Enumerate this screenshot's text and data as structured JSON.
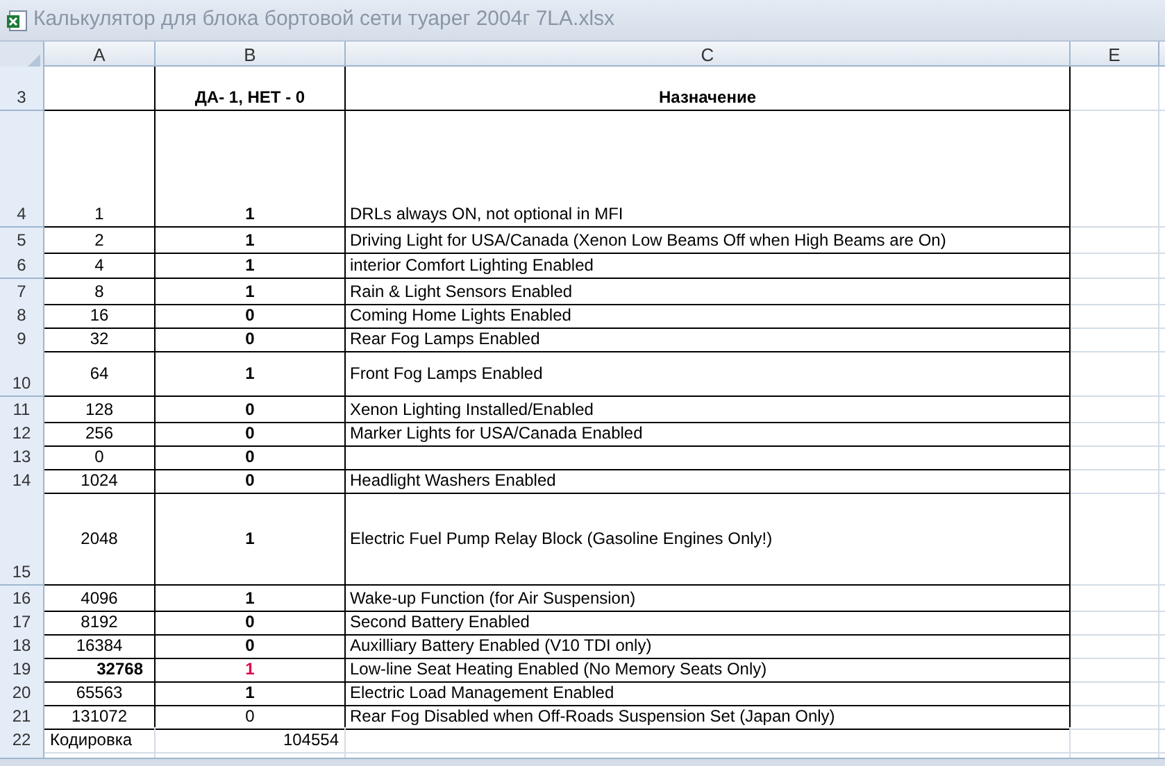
{
  "window": {
    "title": "Калькулятор для блока бортовой сети туарег  2004г 7LA.xlsx"
  },
  "columns": [
    "A",
    "B",
    "C",
    "E"
  ],
  "rows": [
    {
      "row": "3",
      "kind": "header",
      "a": "",
      "b": "ДА- 1, НЕТ - 0",
      "c": "Назначение"
    },
    {
      "row": "4",
      "kind": "normal",
      "a": "1",
      "b": "1",
      "c": "DRLs always ON, not optional in MFI"
    },
    {
      "row": "5",
      "kind": "normal",
      "a": "2",
      "b": "1",
      "c": "Driving Light for USA/Canada (Xenon Low Beams Off when High Beams are On)"
    },
    {
      "row": "6",
      "kind": "normal",
      "a": "4",
      "b": "1",
      "c": "interior Comfort Lighting Enabled"
    },
    {
      "row": "7",
      "kind": "normal",
      "a": "8",
      "b": "1",
      "c": "Rain & Light Sensors Enabled"
    },
    {
      "row": "8",
      "kind": "normal",
      "a": "16",
      "b": "0",
      "c": "Coming Home Lights Enabled"
    },
    {
      "row": "9",
      "kind": "normal",
      "a": "32",
      "b": "0",
      "c": "Rear Fog Lamps Enabled"
    },
    {
      "row": "10",
      "kind": "normal",
      "a": "64",
      "b": "1",
      "c": "Front Fog Lamps Enabled"
    },
    {
      "row": "11",
      "kind": "normal",
      "a": "128",
      "b": "0",
      "c": "Xenon Lighting Installed/Enabled"
    },
    {
      "row": "12",
      "kind": "normal",
      "a": "256",
      "b": "0",
      "c": "Marker Lights for USA/Canada Enabled"
    },
    {
      "row": "13",
      "kind": "normal",
      "a": "0",
      "b": "0",
      "c": ""
    },
    {
      "row": "14",
      "kind": "normal",
      "a": "1024",
      "b": "0",
      "c": "Headlight Washers Enabled"
    },
    {
      "row": "15",
      "kind": "normal",
      "a": "2048",
      "b": "1",
      "c": "Electric Fuel Pump Relay Block (Gasoline Engines Only!)"
    },
    {
      "row": "16",
      "kind": "normal",
      "a": "4096",
      "b": "1",
      "c": "Wake-up Function (for Air Suspension)"
    },
    {
      "row": "17",
      "kind": "normal",
      "a": "8192",
      "b": "0",
      "c": "Second Battery Enabled"
    },
    {
      "row": "18",
      "kind": "normal",
      "a": "16384",
      "b": "0",
      "c": "Auxilliary Battery Enabled (V10 TDI only)"
    },
    {
      "row": "19",
      "kind": "highlight",
      "a": "32768",
      "b": "1",
      "c": "Low-line Seat Heating Enabled (No Memory Seats Only)"
    },
    {
      "row": "20",
      "kind": "normal",
      "a": "65563",
      "b": "1",
      "c": "Electric Load Management Enabled"
    },
    {
      "row": "21",
      "kind": "plain",
      "a": "131072",
      "b": "0",
      "c": "Rear Fog Disabled when Off-Roads Suspension Set (Japan Only)"
    },
    {
      "row": "22",
      "kind": "total",
      "a": "Кодировка",
      "b": "104554",
      "c": ""
    }
  ]
}
